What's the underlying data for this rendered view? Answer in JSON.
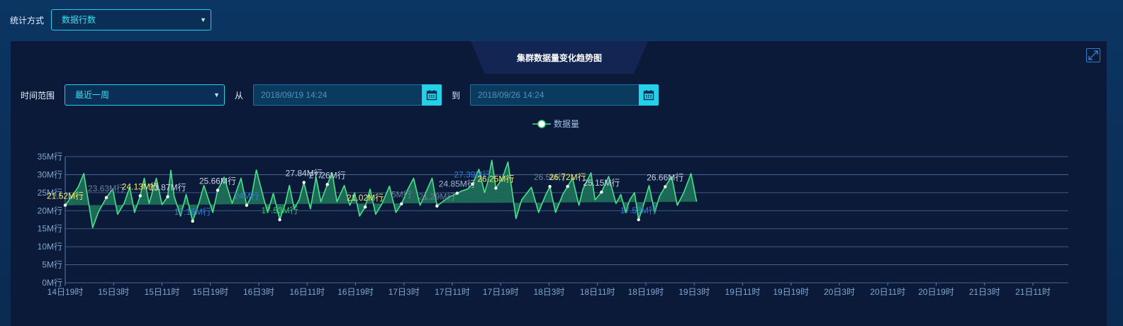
{
  "top": {
    "stat_label": "统计方式",
    "stat_value": "数据行数"
  },
  "panel": {
    "title": "集群数据量变化趋势图"
  },
  "range": {
    "label": "时间范围",
    "value": "最近一周",
    "from_label": "从",
    "from_date": "2018/09/19 14:24",
    "to_label": "到",
    "to_date": "2018/09/26 14:24"
  },
  "icons": {
    "expand": "expand-icon",
    "calendar": "calendar-icon",
    "caret": "caret-down-icon"
  },
  "colors": {
    "accent": "#23d2e8",
    "line": "#4be08a",
    "area": "#1f6e58"
  },
  "chart_data": {
    "type": "area",
    "series": [
      {
        "name": "数据量"
      }
    ],
    "y_unit": "M行",
    "ylim": [
      0,
      35
    ],
    "y_ticks": [
      "0M行",
      "5M行",
      "10M行",
      "15M行",
      "20M行",
      "25M行",
      "30M行",
      "35M行"
    ],
    "x_ticks": [
      "14日19时",
      "15日3时",
      "15日11时",
      "15日19时",
      "16日3时",
      "16日11时",
      "16日19时",
      "17日3时",
      "17日11时",
      "17日19时",
      "18日3时",
      "18日11时",
      "18日19时",
      "19日3时",
      "19日11时",
      "19日19时",
      "20日3时",
      "20日11时",
      "20日19时",
      "21日3时",
      "21日11时"
    ],
    "x": [
      0,
      0.8,
      1.15,
      1.7,
      2.05,
      2.55,
      2.95,
      3.25,
      3.65,
      4.0,
      4.3,
      4.65,
      4.9,
      5.2,
      5.65,
      6.0,
      6.35,
      6.55,
      6.75,
      7.15,
      7.5,
      7.9,
      8.25,
      8.6,
      9.15,
      9.45,
      9.85,
      10.35,
      10.5,
      10.9,
      11.25,
      11.55,
      11.85,
      12.3,
      12.55,
      12.9,
      13.3,
      13.65,
      13.9,
      14.2,
      14.5,
      14.8,
      15.2,
      15.55,
      15.85,
      16.25,
      16.55,
      16.85,
      17.3,
      17.65,
      17.95,
      18.25,
      18.6,
      18.9,
      19.25,
      19.65,
      20.1,
      20.5,
      20.85,
      21.25,
      21.6,
      22.0,
      22.4,
      22.75,
      23.05,
      23.55,
      23.9,
      24.3,
      24.6,
      24.95,
      25.25,
      25.65,
      26.0,
      26.2,
      26.45,
      26.7,
      27.1,
      27.45,
      27.95,
      28.3,
      28.9,
      29.35,
      29.75,
      30.05,
      30.4,
      30.85,
      31.15,
      31.45,
      31.85,
      32.1,
      32.6,
      32.85,
      33.25,
      33.7,
      34.15,
      34.45,
      34.75,
      35.0,
      35.3,
      35.55,
      35.85,
      36.2,
      36.55,
      36.85,
      37.2,
      37.6,
      37.95,
      38.35,
      38.8,
      39.15,
      39.45,
      39.85,
      40.25,
      40.6,
      40.95,
      41.2,
      41.6,
      42.15,
      42.4,
      42.8,
      43.2,
      43.6,
      44.0,
      44.45,
      44.9,
      45.35,
      45.7,
      46.15,
      46.55,
      46.95,
      47.3,
      47.6,
      47.95,
      48.25,
      48.6,
      48.85,
      49.1,
      49.35,
      49.65,
      50.05,
      50.45,
      50.8,
      51.15,
      51.45,
      51.65,
      52.15,
      52.45,
      52.75,
      53.0,
      53.3,
      53.65,
      54.0,
      54.4,
      54.75,
      55.0,
      55.35,
      55.75,
      56.15,
      56.45,
      56.85,
      57.2,
      57.65,
      58.0,
      58.35,
      58.65,
      59.05,
      59.5,
      59.9,
      60.2
    ],
    "y": [
      21.52,
      26.5,
      30.3,
      15.3,
      19.5,
      23.63,
      26.0,
      19.0,
      22.0,
      26.5,
      19.5,
      24.13,
      29.0,
      22.0,
      29.0,
      21.7,
      23.87,
      31.2,
      24.0,
      18.5,
      24.5,
      17.1,
      21.5,
      27.0,
      19.5,
      25.66,
      29.3,
      22.0,
      24.0,
      29.0,
      21.5,
      24.0,
      31.3,
      23.5,
      19.5,
      24.8,
      17.5,
      22.0,
      27.0,
      20.5,
      23.0,
      27.84,
      20.5,
      29.3,
      22.5,
      27.26,
      30.5,
      22.5,
      27.0,
      21.5,
      25.0,
      18.5,
      21.02,
      26.0,
      19.0,
      22.0,
      26.8,
      19.5,
      21.9,
      26.0,
      29.0,
      21.5,
      25.5,
      29.0,
      21.29,
      23.0,
      24.0,
      24.85,
      25.5,
      26.0,
      27.39,
      31.5,
      25.0,
      28.0,
      34.0,
      26.25,
      29.0,
      33.5,
      17.8,
      23.0,
      26.5,
      19.5,
      24.0,
      26.7,
      19.5,
      24.5,
      26.72,
      29.0,
      21.5,
      26.0,
      30.5,
      23.0,
      25.15,
      29.5,
      22.0,
      24.5,
      19.5,
      23.0,
      25.0,
      17.5,
      21.5,
      27.0,
      19.5,
      24.0,
      26.66,
      29.5,
      21.5,
      25.0,
      30.3,
      22.5
    ],
    "labels": [
      "21.52M行",
      "23.63M行",
      "24.13M行",
      "23.87M行",
      "17.16M行",
      "25.66M行",
      "24M行",
      "17.53M行",
      "27.84M行",
      "27.26M行",
      "21.02M行",
      "5M行",
      "21.29M行",
      "24.85M行",
      "27.39M行",
      "26.25M行",
      "26.5M行",
      "26.72M行",
      "25.15M行",
      "17.53M行",
      "26.66M行"
    ],
    "grid": true,
    "legend_position": "top-center"
  }
}
